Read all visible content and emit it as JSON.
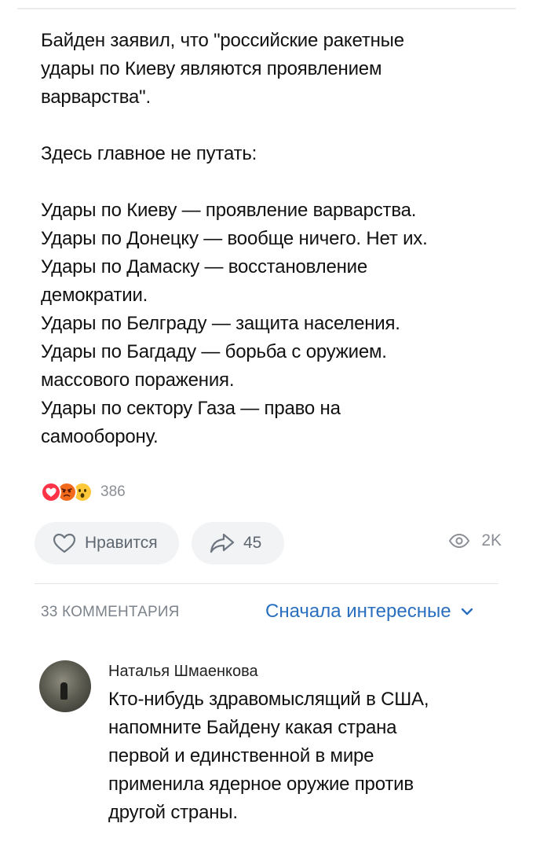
{
  "post": {
    "lines": [
      "Байден заявил, что \"российские ракетные",
      "удары по Киеву являются проявлением",
      "варварства\".",
      "",
      "Здесь главное не путать:",
      "",
      "Удары по Киеву — проявление варварства.",
      "Удары по Донецку — вообще ничего. Нет их.",
      "Удары по Дамаску — восстановление",
      "демократии.",
      "Удары по Белграду — защита населения.",
      "Удары по Багдаду — борьба с оружием.",
      "массового поражения.",
      "Удары по сектору Газа — право на",
      "самооборону."
    ]
  },
  "reactions": {
    "icons": [
      "heart-reaction-icon",
      "angry-reaction-icon",
      "wow-reaction-icon"
    ],
    "count": "386",
    "colors": {
      "heart": "#ff3347",
      "angry": "#f26b1d",
      "wow": "#ffc83a"
    }
  },
  "actions": {
    "like_label": "Нравится",
    "share_count": "45",
    "views_count": "2K",
    "icons": {
      "like": "heart-outline-icon",
      "share": "share-arrow-icon",
      "views": "eye-icon"
    }
  },
  "comments": {
    "header": "33 КОММЕНТАРИЯ",
    "sort_label": "Сначала интересные",
    "accent_color": "#2a6fbf",
    "items": [
      {
        "author": "Наталья Шмаенкова",
        "lines": [
          "Кто-нибудь здравомыслящий в США,",
          "напомните Байдену какая страна",
          "первой и единственной в мире",
          "применила ядерное оружие против",
          "другой страны."
        ]
      }
    ]
  }
}
